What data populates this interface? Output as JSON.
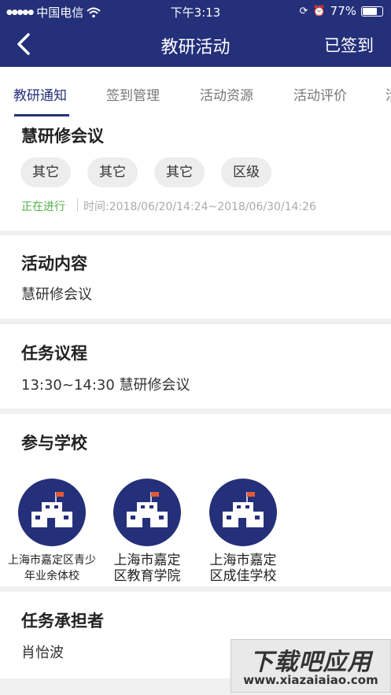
{
  "status_bar": {
    "carrier": "中国电信",
    "time": "下午3:13",
    "battery": "77%",
    "battery_level": 0.77
  },
  "nav": {
    "title": "教研活动",
    "right_action": "已签到"
  },
  "tabs": [
    {
      "label": "教研通知",
      "active": true
    },
    {
      "label": "签到管理"
    },
    {
      "label": "活动资源"
    },
    {
      "label": "活动评价"
    },
    {
      "label": "活"
    }
  ],
  "meeting": {
    "title": "慧研修会议",
    "tags": [
      "其它",
      "其它",
      "其它",
      "区级"
    ],
    "status": "正在进行",
    "time": "时间:2018/06/20/14:24~2018/06/30/14:26"
  },
  "content": {
    "heading": "活动内容",
    "text": "慧研修会议"
  },
  "agenda": {
    "heading": "任务议程",
    "text": "13:30~14:30 慧研修会议"
  },
  "schools": {
    "heading": "参与学校",
    "items": [
      {
        "name": "上海市嘉定区青少年业余体校"
      },
      {
        "name": "上海市嘉定区教育学院"
      },
      {
        "name": "上海市嘉定区成佳学校"
      }
    ]
  },
  "assignee": {
    "heading": "任务承担者",
    "name": "肖怡波"
  },
  "watermark": {
    "line1": "下载吧应用",
    "line2": "www.xiazaiaiao.com"
  },
  "colors": {
    "primary": "#25307a",
    "status_green": "#55b04a"
  }
}
